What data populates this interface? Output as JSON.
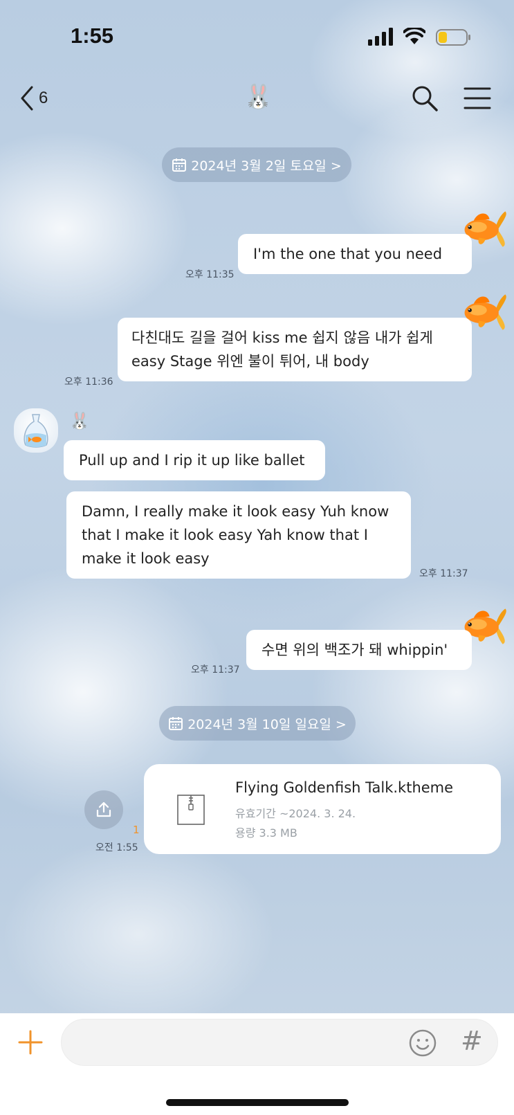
{
  "status_bar": {
    "time": "1:55"
  },
  "header": {
    "back_count": "6",
    "title_emoji": "🐰"
  },
  "date_dividers": [
    {
      "label": "2024년 3월 2일 토요일 >"
    },
    {
      "label": "2024년 3월 10일 일요일 >"
    }
  ],
  "messages": [
    {
      "direction": "outgoing",
      "text": "I'm the one that you need",
      "time": "오후 11:35"
    },
    {
      "direction": "outgoing",
      "text": "다친대도 길을 걸어 kiss me 쉽지 않음 내가 쉽게 easy Stage 위엔 불이 튀어, 내 body",
      "time": "오후 11:36"
    },
    {
      "direction": "incoming",
      "sender": "🐰",
      "text": "Pull up and I rip it up like ballet"
    },
    {
      "direction": "incoming",
      "text": "Damn, I really make it look easy Yuh know that I make it look easy Yah know that I make it look easy",
      "time": "오후 11:37"
    },
    {
      "direction": "outgoing",
      "text": "수면 위의 백조가 돼 whippin'",
      "time": "오후 11:37"
    }
  ],
  "file_message": {
    "name": "Flying Goldenfish Talk.ktheme",
    "expiry": "유효기간 ~2024. 3. 24.",
    "size": "용량 3.3 MB",
    "time": "오전 1:55",
    "unread": "1"
  },
  "input": {
    "placeholder": "",
    "value": ""
  },
  "icons": {
    "back": "chevron-left-icon",
    "search": "search-icon",
    "menu": "hamburger-menu-icon",
    "calendar": "calendar-icon",
    "share": "share-icon",
    "file": "zip-file-icon",
    "add": "plus-icon",
    "emoji": "smiley-icon",
    "hashtag": "hashtag-icon"
  },
  "colors": {
    "accent": "#f0932b",
    "bubble": "#ffffff",
    "chip": "#8ca0b9"
  }
}
